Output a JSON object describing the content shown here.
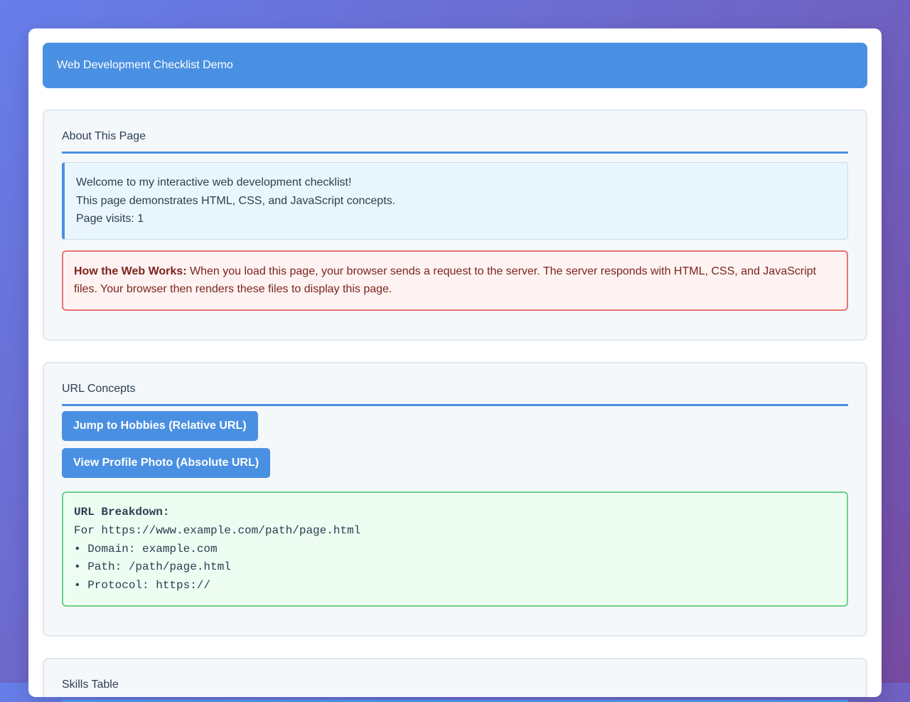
{
  "header": {
    "title": "Web Development Checklist Demo"
  },
  "about": {
    "title": "About This Page",
    "info_lines": [
      "Welcome to my interactive web development checklist!",
      "This page demonstrates HTML, CSS, and JavaScript concepts.",
      "Page visits: 1"
    ],
    "web_works_label": "How the Web Works:",
    "web_works_text": " When you load this page, your browser sends a request to the server. The server responds with HTML, CSS, and JavaScript files. Your browser then renders these files to display this page."
  },
  "url": {
    "title": "URL Concepts",
    "jump_button": "Jump to Hobbies (Relative URL)",
    "photo_button": "View Profile Photo (Absolute URL)",
    "breakdown_title": "URL Breakdown:",
    "breakdown_lines": [
      "For https://www.example.com/path/page.html",
      "• Domain: example.com",
      "• Path: /path/page.html",
      "• Protocol: https://"
    ]
  },
  "skills": {
    "title": "Skills Table"
  },
  "colors": {
    "accent": "#4a90e2",
    "background_start": "#667eea",
    "background_end": "#764ba2"
  }
}
